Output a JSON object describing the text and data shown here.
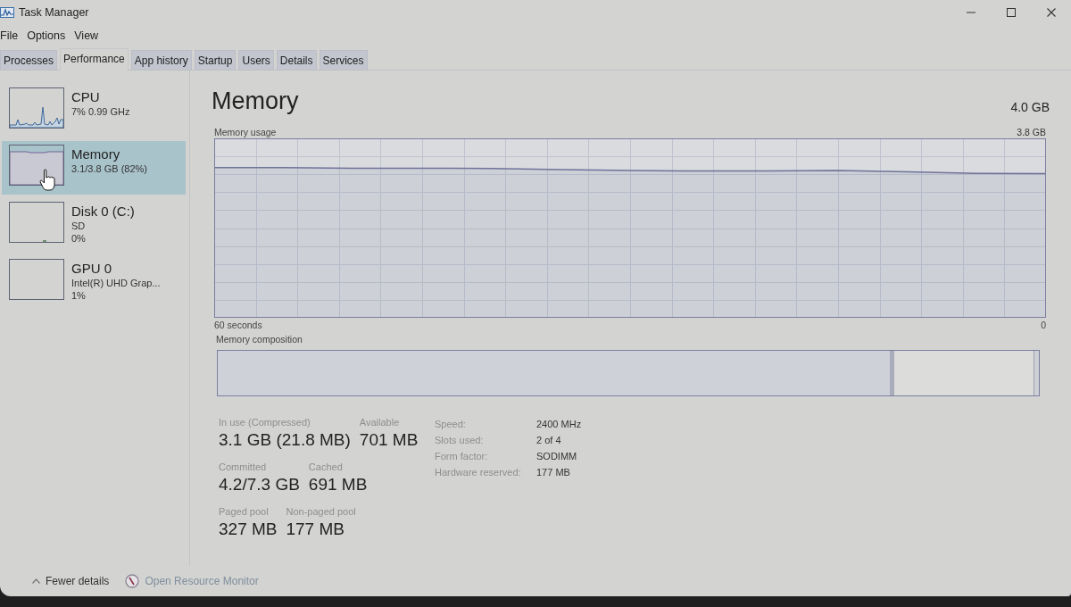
{
  "window": {
    "title": "Task Manager"
  },
  "menu": [
    "File",
    "Options",
    "View"
  ],
  "tabs": [
    {
      "label": "Processes",
      "selected": false
    },
    {
      "label": "Performance",
      "selected": true
    },
    {
      "label": "App history",
      "selected": false
    },
    {
      "label": "Startup",
      "selected": false
    },
    {
      "label": "Users",
      "selected": false
    },
    {
      "label": "Details",
      "selected": false
    },
    {
      "label": "Services",
      "selected": false
    }
  ],
  "sidebar": {
    "items": [
      {
        "kind": "cpu",
        "name": "CPU",
        "details": [
          "7% 0.99 GHz"
        ],
        "selected": false
      },
      {
        "kind": "memory",
        "name": "Memory",
        "details": [
          "3.1/3.8 GB (82%)"
        ],
        "selected": true
      },
      {
        "kind": "disk",
        "name": "Disk 0 (C:)",
        "details": [
          "SD",
          "0%"
        ],
        "selected": false
      },
      {
        "kind": "gpu",
        "name": "GPU 0",
        "details": [
          "Intel(R) UHD Grap...",
          "1%"
        ],
        "selected": false
      }
    ]
  },
  "panel": {
    "title": "Memory",
    "capacity": "4.0 GB",
    "usage": {
      "label": "Memory usage",
      "max_label": "3.8 GB",
      "start_label": "60 seconds",
      "end_label": "0"
    },
    "composition": {
      "label": "Memory composition"
    },
    "stats": [
      {
        "label": "In use (Compressed)",
        "value": "3.1 GB (21.8 MB)"
      },
      {
        "label": "Available",
        "value": "701 MB"
      },
      {
        "label": "Committed",
        "value": "4.2/7.3 GB"
      },
      {
        "label": "Cached",
        "value": "691 MB"
      },
      {
        "label": "Paged pool",
        "value": "327 MB"
      },
      {
        "label": "Non-paged pool",
        "value": "177 MB"
      }
    ],
    "properties": [
      {
        "label": "Speed:",
        "value": "2400 MHz"
      },
      {
        "label": "Slots used:",
        "value": "2 of 4"
      },
      {
        "label": "Form factor:",
        "value": "SODIMM"
      },
      {
        "label": "Hardware reserved:",
        "value": "177 MB"
      }
    ]
  },
  "footer": {
    "toggle": "Fewer details",
    "link": "Open Resource Monitor"
  }
}
